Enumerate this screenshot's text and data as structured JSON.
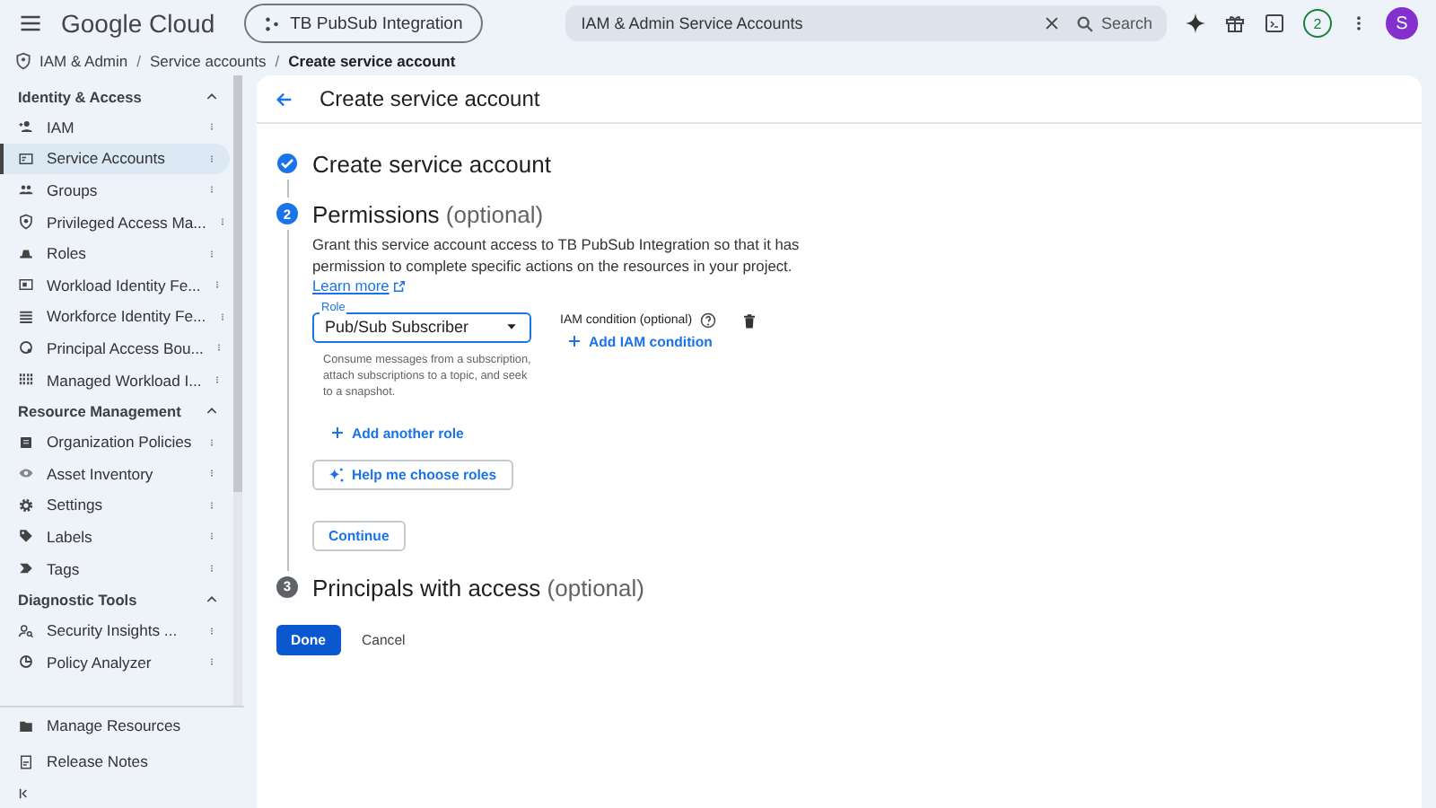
{
  "topbar": {
    "product": "Google Cloud",
    "project": "TB PubSub Integration",
    "search_value": "IAM & Admin Service Accounts",
    "search_button": "Search",
    "notification_count": "2",
    "avatar_initial": "S"
  },
  "breadcrumb": [
    {
      "kind": "link",
      "text": "IAM & Admin"
    },
    {
      "kind": "separator",
      "text": "/"
    },
    {
      "kind": "link",
      "text": "Service accounts"
    },
    {
      "kind": "separator",
      "text": "/"
    },
    {
      "kind": "current",
      "text": "Create service account"
    }
  ],
  "sidebar": {
    "sections": [
      {
        "title": "Identity & Access",
        "expanded": true,
        "items": [
          {
            "label": "IAM",
            "selected": false
          },
          {
            "label": "Service Accounts",
            "selected": true
          },
          {
            "label": "Groups",
            "selected": false
          },
          {
            "label": "Privileged Access Ma...",
            "selected": false
          },
          {
            "label": "Roles",
            "selected": false
          },
          {
            "label": "Workload Identity Fe...",
            "selected": false
          },
          {
            "label": "Workforce Identity Fe...",
            "selected": false
          },
          {
            "label": "Principal Access Bou...",
            "selected": false
          },
          {
            "label": "Managed Workload I...",
            "selected": false
          }
        ]
      },
      {
        "title": "Resource Management",
        "expanded": true,
        "items": [
          {
            "label": "Organization Policies",
            "selected": false
          },
          {
            "label": "Asset Inventory",
            "selected": false
          },
          {
            "label": "Settings",
            "selected": false
          },
          {
            "label": "Labels",
            "selected": false
          },
          {
            "label": "Tags",
            "selected": false
          }
        ]
      },
      {
        "title": "Diagnostic Tools",
        "expanded": true,
        "items": [
          {
            "label": "Security Insights ...",
            "selected": false
          },
          {
            "label": "Policy Analyzer",
            "selected": false
          }
        ]
      }
    ],
    "footer": [
      "Manage Resources",
      "Release Notes"
    ]
  },
  "page": {
    "title": "Create service account",
    "steps": [
      {
        "kind": "done",
        "title": "Create service account"
      },
      {
        "kind": "active",
        "number": "2",
        "title": "Permissions",
        "optional": "(optional)",
        "description": "Grant this service account access to TB PubSub Integration so that it has permission to complete specific actions on the resources in your project.",
        "link": "Learn more",
        "role": {
          "label": "Role",
          "value": "Pub/Sub Subscriber",
          "help": "Consume messages from a subscription, attach subscriptions to a topic, and seek to a snapshot."
        },
        "condition": {
          "label": "IAM condition (optional)",
          "action": "Add IAM condition"
        },
        "add_role": "Add another role",
        "help_button": "Help me choose roles",
        "continue": "Continue"
      },
      {
        "kind": "pending",
        "number": "3",
        "title": "Principals with access",
        "optional": "(optional)"
      }
    ],
    "actions": {
      "done": "Done",
      "cancel": "Cancel"
    }
  }
}
